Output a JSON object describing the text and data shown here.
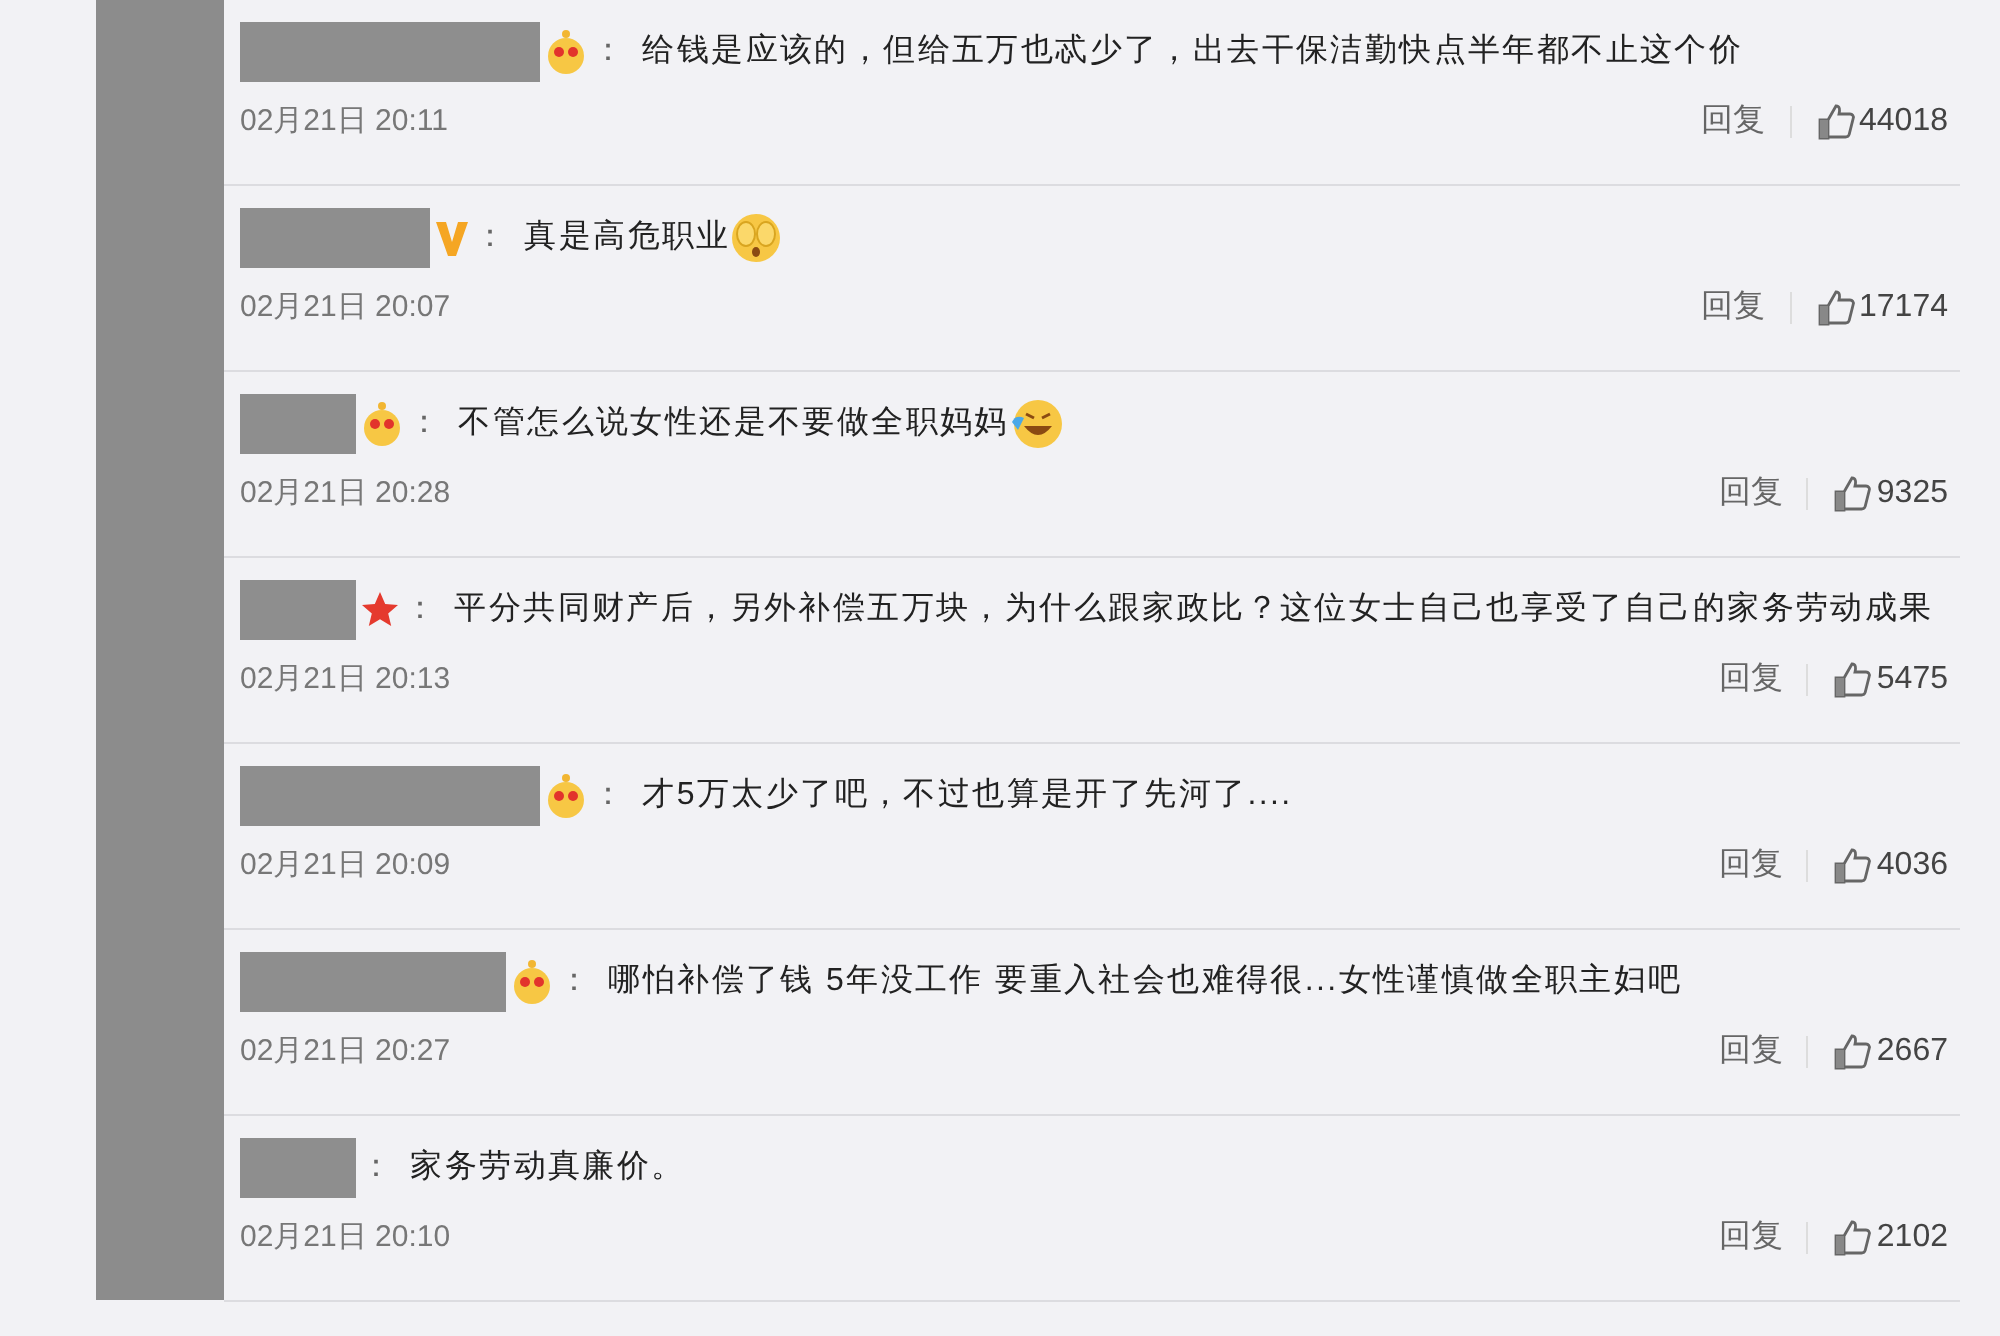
{
  "comments": [
    {
      "name_redaction": {
        "kind": "long"
      },
      "badge": {
        "kind": "crown"
      },
      "colon": "：",
      "text": "给钱是应该的，但给五万也忒少了，出去干保洁勤快点半年都不止这个价",
      "date": "02月21日 20:11",
      "reply": "回复",
      "likes": "44018"
    },
    {
      "name_redaction": {
        "kind": "medium"
      },
      "badge": {
        "kind": "vip"
      },
      "colon": "：",
      "text": "真是高危职业",
      "emoji": {
        "kind": "covering-face"
      },
      "date": "02月21日 20:07",
      "reply": "回复",
      "likes": "17174"
    },
    {
      "name_redaction": {
        "kind": "short"
      },
      "badge": {
        "kind": "crown"
      },
      "colon": "：",
      "text": "不管怎么说女性还是不要做全职妈妈",
      "emoji": {
        "kind": "laughing-crying"
      },
      "date": "02月21日 20:28",
      "reply": "回复",
      "likes": "9325"
    },
    {
      "name_redaction": {
        "kind": "short"
      },
      "badge": {
        "kind": "star"
      },
      "colon": "：",
      "text": "平分共同财产后，另外补偿五万块，为什么跟家政比？这位女士自己也享受了自己的家务劳动成果",
      "date": "02月21日 20:13",
      "reply": "回复",
      "likes": "5475"
    },
    {
      "name_redaction": {
        "kind": "long"
      },
      "badge": {
        "kind": "crown"
      },
      "colon": "：",
      "text": "才5万太少了吧，不过也算是开了先河了....",
      "date": "02月21日 20:09",
      "reply": "回复",
      "likes": "4036"
    },
    {
      "name_redaction": {
        "kind": "wide"
      },
      "badge": {
        "kind": "crown"
      },
      "colon": "：",
      "text": "哪怕补偿了钱 5年没工作 要重入社会也难得很...女性谨慎做全职主妇吧",
      "date": "02月21日 20:27",
      "reply": "回复",
      "likes": "2667"
    },
    {
      "name_redaction": {
        "kind": "short"
      },
      "colon": "：",
      "text": "家务劳动真廉价。",
      "date": "02月21日 20:10",
      "reply": "回复",
      "likes": "2102"
    }
  ]
}
